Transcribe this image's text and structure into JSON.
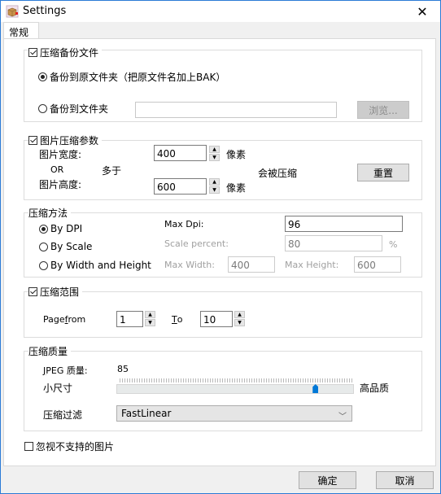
{
  "window": {
    "title": "Settings",
    "icon": "package-box-icon",
    "close_glyph": "✕"
  },
  "tabs": [
    {
      "label": "常规",
      "active": true
    }
  ],
  "backup": {
    "title": "压缩备份文件",
    "checked": true,
    "option_original": "备份到原文件夹（把原文件名加上BAK）",
    "option_folder": "备份到文件夹",
    "selected": "original",
    "folder_value": "",
    "browse_label": "浏览..."
  },
  "image_params": {
    "title": "图片压缩参数",
    "checked": true,
    "width_label": "图片宽度:",
    "width_value": "400",
    "width_unit": "像素",
    "or_label": "OR",
    "more_than": "多于",
    "height_label": "图片高度:",
    "height_value": "600",
    "height_unit": "像素",
    "will_compress": "会被压缩",
    "reset_label": "重置"
  },
  "method": {
    "title": "压缩方法",
    "options": [
      "By DPI",
      "By Scale",
      "By Width and Height"
    ],
    "selected": "By DPI",
    "max_dpi_label": "Max Dpi:",
    "max_dpi_value": "96",
    "scale_label": "Scale percent:",
    "scale_value": "80",
    "percent_sign": "%",
    "max_width_label": "Max Width:",
    "max_width_value": "400",
    "max_height_label": "Max Height:",
    "max_height_value": "600"
  },
  "range": {
    "title": "压缩范围",
    "checked": true,
    "page_from_prefix": "Page ",
    "page_from_mnemonic": "f",
    "page_from_suffix": "rom",
    "from_value": "1",
    "to_mnemonic": "T",
    "to_suffix": "o",
    "to_value": "10"
  },
  "quality": {
    "title": "压缩质量",
    "jpeg_mnemonic": "J",
    "jpeg_label_rest": "PEG 质量:",
    "jpeg_value": "85",
    "small_label": "小尺寸",
    "high_label": "高品质",
    "slider_value": 85,
    "slider_min": 0,
    "slider_max": 100,
    "filter_label": "压缩过滤",
    "filter_value": "FastLinear"
  },
  "ignore": {
    "label": "忽视不支持的图片",
    "checked": false
  },
  "footer": {
    "ok_label": "确定",
    "cancel_label": "取消"
  },
  "colors": {
    "accent": "#0078d7",
    "window_border": "#2b7bd6"
  }
}
